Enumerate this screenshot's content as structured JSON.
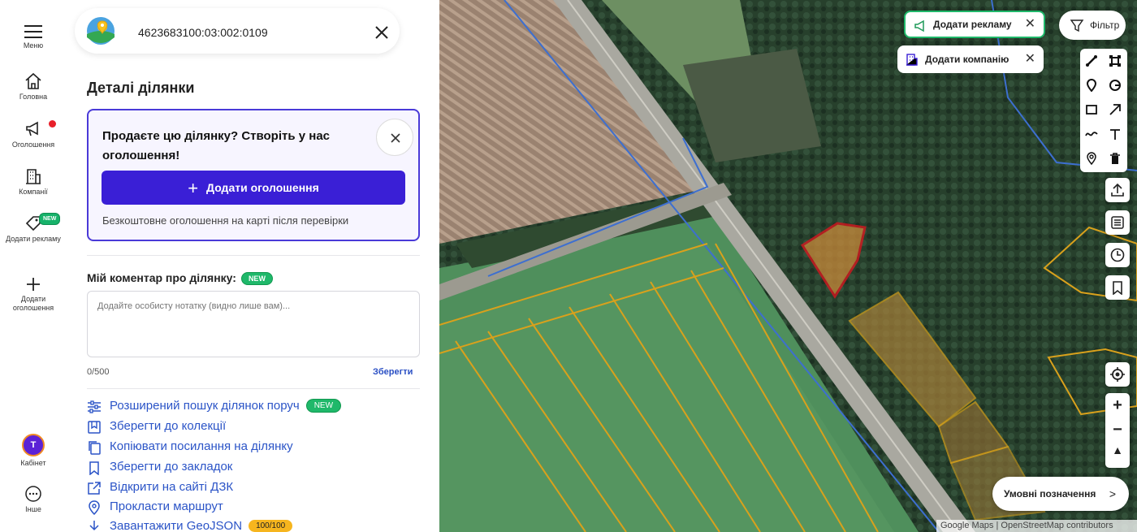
{
  "rail": {
    "menu": "Меню",
    "home": "Головна",
    "ads": "Оголошення",
    "companies": "Компанії",
    "advertise": "Додати рекламу",
    "advertise_badge": "NEW",
    "add_ad": "Додати оголошення",
    "cabinet": "Кабінет",
    "cabinet_initial": "Т",
    "other": "Інше"
  },
  "parcel": {
    "cadastral_number": "4623683100:03:002:0109",
    "heading": "Деталі ділянки"
  },
  "promo": {
    "title": "Продаєте цю ділянку? Створіть у нас оголошення!",
    "button_label": "Додати оголошення",
    "note": "Безкоштовне оголошення на карті після перевірки"
  },
  "comment": {
    "label": "Мій коментар про ділянку:",
    "badge": "NEW",
    "placeholder": "Додайте особисту нотатку (видно лише вам)...",
    "counter": "0/500",
    "save_label": "Зберегти"
  },
  "actions": [
    {
      "label": "Розширений пошук ділянок поруч",
      "badge": "NEW",
      "icon": "sliders-icon"
    },
    {
      "label": "Зберегти до колекції",
      "icon": "collection-icon"
    },
    {
      "label": "Копіювати посилання на ділянку",
      "icon": "copy-icon"
    },
    {
      "label": "Зберегти до закладок",
      "icon": "bookmark-icon"
    },
    {
      "label": "Відкрити на сайті ДЗК",
      "icon": "external-link-icon"
    },
    {
      "label": "Прокласти маршрут",
      "icon": "location-pin-icon"
    },
    {
      "label": "Завантажити GeoJSON",
      "badge": "100/100",
      "icon": "download-icon"
    }
  ],
  "map": {
    "add_advertising": "Додати рекламу",
    "add_company": "Додати компанію",
    "filter": "Фільтр",
    "legend": "Умовні позначення",
    "attribution": "Google Maps | OpenStreetMap contributors"
  },
  "colors": {
    "accent": "#3a1fd6",
    "link": "#2b54c7",
    "new_badge": "#1fb86a",
    "parcel_outline": "#d9a11c",
    "selected_parcel": "#e0141e"
  }
}
